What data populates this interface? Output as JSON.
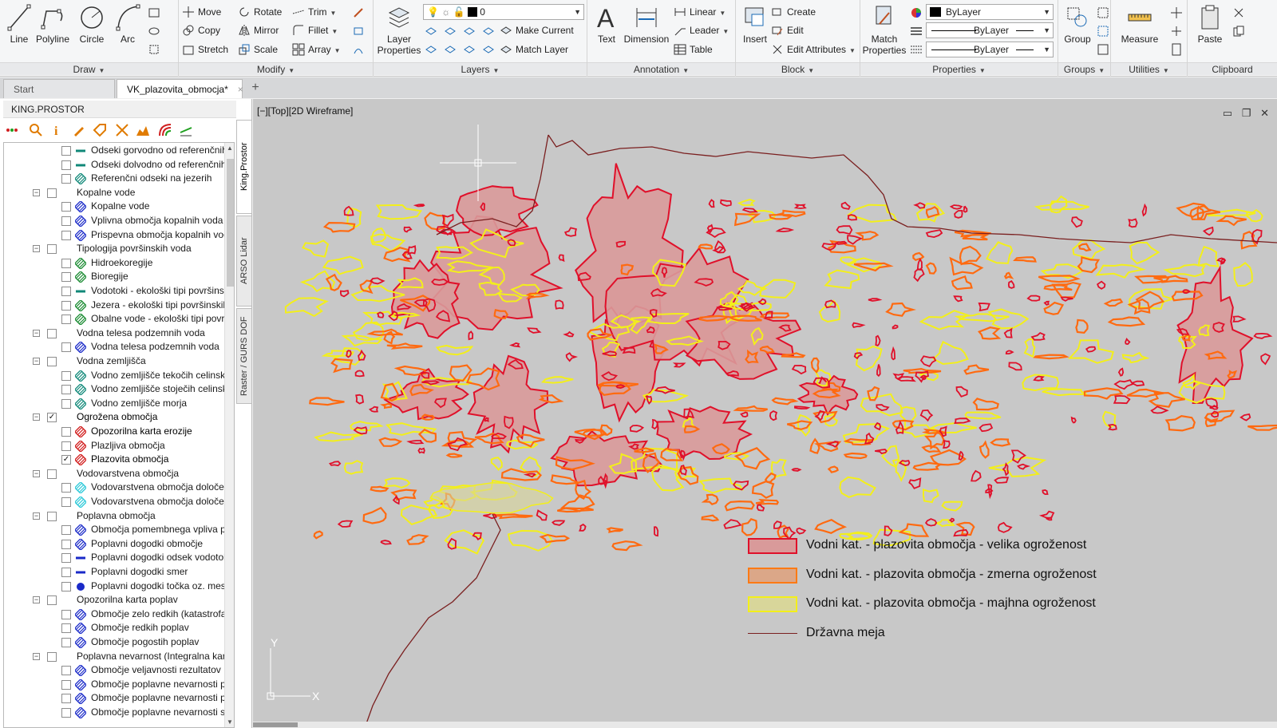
{
  "ribbon": {
    "draw": {
      "title": "Draw",
      "line": "Line",
      "polyline": "Polyline",
      "circle": "Circle",
      "arc": "Arc"
    },
    "modify": {
      "title": "Modify",
      "move": "Move",
      "rotate": "Rotate",
      "trim": "Trim",
      "copy": "Copy",
      "mirror": "Mirror",
      "fillet": "Fillet",
      "stretch": "Stretch",
      "scale": "Scale",
      "array": "Array"
    },
    "layers": {
      "title": "Layers",
      "layer_properties": "Layer Properties",
      "current_layer": "0",
      "make_current": "Make Current",
      "match_layer": "Match Layer"
    },
    "annotation": {
      "title": "Annotation",
      "text": "Text",
      "dimension": "Dimension",
      "linear": "Linear",
      "leader": "Leader",
      "table": "Table"
    },
    "block": {
      "title": "Block",
      "insert": "Insert",
      "create": "Create",
      "edit": "Edit",
      "edit_attributes": "Edit Attributes"
    },
    "properties": {
      "title": "Properties",
      "match_properties": "Match Properties",
      "color": "ByLayer",
      "linetype": "ByLayer",
      "lineweight": "ByLayer"
    },
    "groups": {
      "title": "Groups",
      "group": "Group"
    },
    "utilities": {
      "title": "Utilities",
      "measure": "Measure"
    },
    "clipboard": {
      "title": "Clipboard",
      "paste": "Paste"
    }
  },
  "tabs": [
    {
      "label": "Start"
    },
    {
      "label": "VK_plazovita_obmocja*",
      "close": "×"
    }
  ],
  "add_tab": "+",
  "palette": {
    "title": "KING.PROSTOR",
    "side_tabs": [
      "King.Prostor",
      "ARSO Lidar",
      "Raster / GURS DOF"
    ],
    "tree": [
      {
        "label": "Odseki gorvodno od referenčnih",
        "level": 2,
        "checked": false,
        "icon": "line-teal"
      },
      {
        "label": "Odseki dolvodno od referenčnih",
        "level": 2,
        "checked": false,
        "icon": "line-teal"
      },
      {
        "label": "Referenčni odseki na jezerih",
        "level": 2,
        "checked": false,
        "icon": "hatch-teal"
      },
      {
        "label": "Kopalne vode",
        "level": 1,
        "checked": false,
        "expand": "−"
      },
      {
        "label": "Kopalne vode",
        "level": 2,
        "checked": false,
        "icon": "hatch-blue"
      },
      {
        "label": "Vplivna območja kopalnih voda",
        "level": 2,
        "checked": false,
        "icon": "hatch-blue"
      },
      {
        "label": "Prispevna območja kopalnih voda",
        "level": 2,
        "checked": false,
        "icon": "hatch-blue"
      },
      {
        "label": "Tipologija površinskih voda",
        "level": 1,
        "checked": false,
        "expand": "−"
      },
      {
        "label": "Hidroekoregije",
        "level": 2,
        "checked": false,
        "icon": "hatch-green"
      },
      {
        "label": "Bioregije",
        "level": 2,
        "checked": false,
        "icon": "hatch-green"
      },
      {
        "label": "Vodotoki - ekološki tipi površinskih",
        "level": 2,
        "checked": false,
        "icon": "line-teal"
      },
      {
        "label": "Jezera - ekološki tipi površinskih",
        "level": 2,
        "checked": false,
        "icon": "hatch-green"
      },
      {
        "label": "Obalne vode - ekološki tipi površinskih",
        "level": 2,
        "checked": false,
        "icon": "hatch-green"
      },
      {
        "label": "Vodna telesa podzemnih voda",
        "level": 1,
        "checked": false,
        "expand": "−"
      },
      {
        "label": "Vodna telesa podzemnih voda",
        "level": 2,
        "checked": false,
        "icon": "hatch-blue"
      },
      {
        "label": "Vodna zemljišča",
        "level": 1,
        "checked": false,
        "expand": "−"
      },
      {
        "label": "Vodno zemljišče tekočih celinskih",
        "level": 2,
        "checked": false,
        "icon": "hatch-teal"
      },
      {
        "label": "Vodno zemljišče stoječih celinskih",
        "level": 2,
        "checked": false,
        "icon": "hatch-teal"
      },
      {
        "label": "Vodno zemljišče morja",
        "level": 2,
        "checked": false,
        "icon": "hatch-teal"
      },
      {
        "label": "Ogrožena območja",
        "level": 1,
        "checked": true,
        "expand": "−",
        "bold": true
      },
      {
        "label": "Opozorilna karta erozije",
        "level": 2,
        "checked": false,
        "icon": "hatch-red",
        "bold": true
      },
      {
        "label": "Plazljiva območja",
        "level": 2,
        "checked": false,
        "icon": "hatch-red"
      },
      {
        "label": "Plazovita območja",
        "level": 2,
        "checked": true,
        "icon": "hatch-red",
        "bold": true
      },
      {
        "label": "Vodovarstvena območja",
        "level": 1,
        "checked": false,
        "expand": "−"
      },
      {
        "label": "Vodovarstvena območja določena",
        "level": 2,
        "checked": false,
        "icon": "hatch-cyan"
      },
      {
        "label": "Vodovarstvena območja določena",
        "level": 2,
        "checked": false,
        "icon": "hatch-cyan"
      },
      {
        "label": "Poplavna območja",
        "level": 1,
        "checked": false,
        "expand": "−"
      },
      {
        "label": "Območja pomembnega vpliva poplav",
        "level": 2,
        "checked": false,
        "icon": "hatch-blue"
      },
      {
        "label": "Poplavni dogodki območje",
        "level": 2,
        "checked": false,
        "icon": "hatch-blue"
      },
      {
        "label": "Poplavni dogodki odsek vodotoka",
        "level": 2,
        "checked": false,
        "icon": "line-blue"
      },
      {
        "label": "Poplavni dogodki smer",
        "level": 2,
        "checked": false,
        "icon": "line-blue"
      },
      {
        "label": "Poplavni dogodki točka oz. mesto",
        "level": 2,
        "checked": false,
        "icon": "dot-blue"
      },
      {
        "label": "Opozorilna karta poplav",
        "level": 1,
        "checked": false,
        "expand": "−"
      },
      {
        "label": "Območje zelo redkih (katastrofalnih)",
        "level": 2,
        "checked": false,
        "icon": "hatch-blue"
      },
      {
        "label": "Območje redkih poplav",
        "level": 2,
        "checked": false,
        "icon": "hatch-blue"
      },
      {
        "label": "Območje pogostih poplav",
        "level": 2,
        "checked": false,
        "icon": "hatch-blue"
      },
      {
        "label": "Poplavna nevarnost (Integralna karta)",
        "level": 1,
        "checked": false,
        "expand": "−"
      },
      {
        "label": "Območje veljavnosti rezultatov",
        "level": 2,
        "checked": false,
        "icon": "hatch-blue"
      },
      {
        "label": "Območje poplavne nevarnosti p",
        "level": 2,
        "checked": false,
        "icon": "hatch-blue"
      },
      {
        "label": "Območje poplavne nevarnosti p",
        "level": 2,
        "checked": false,
        "icon": "hatch-blue"
      },
      {
        "label": "Območje poplavne nevarnosti s",
        "level": 2,
        "checked": false,
        "icon": "hatch-blue"
      }
    ]
  },
  "viewport": {
    "label": "[−][Top][2D Wireframe]",
    "ucs_x": "X",
    "ucs_y": "Y"
  },
  "legend": [
    {
      "label": "Vodni kat. - plazovita območja - velika ogroženost",
      "fill": "#d99a9a",
      "stroke": "#e0102a"
    },
    {
      "label": "Vodni kat. - plazovita območja - zmerna ogroženost",
      "fill": "#dba788",
      "stroke": "#ff7a14"
    },
    {
      "label": "Vodni kat. - plazovita območja - majhna ogroženost",
      "fill": "#d8d69a",
      "stroke": "#f3ef1a"
    },
    {
      "label": "Državna meja",
      "stroke": "#7a1f1f"
    }
  ],
  "colors": {
    "canvas_bg": "#c8c8c8",
    "high_risk": "#e0102a",
    "medium_risk": "#ff6a10",
    "low_risk": "#f3ef1a",
    "border": "#7a1f1f"
  }
}
